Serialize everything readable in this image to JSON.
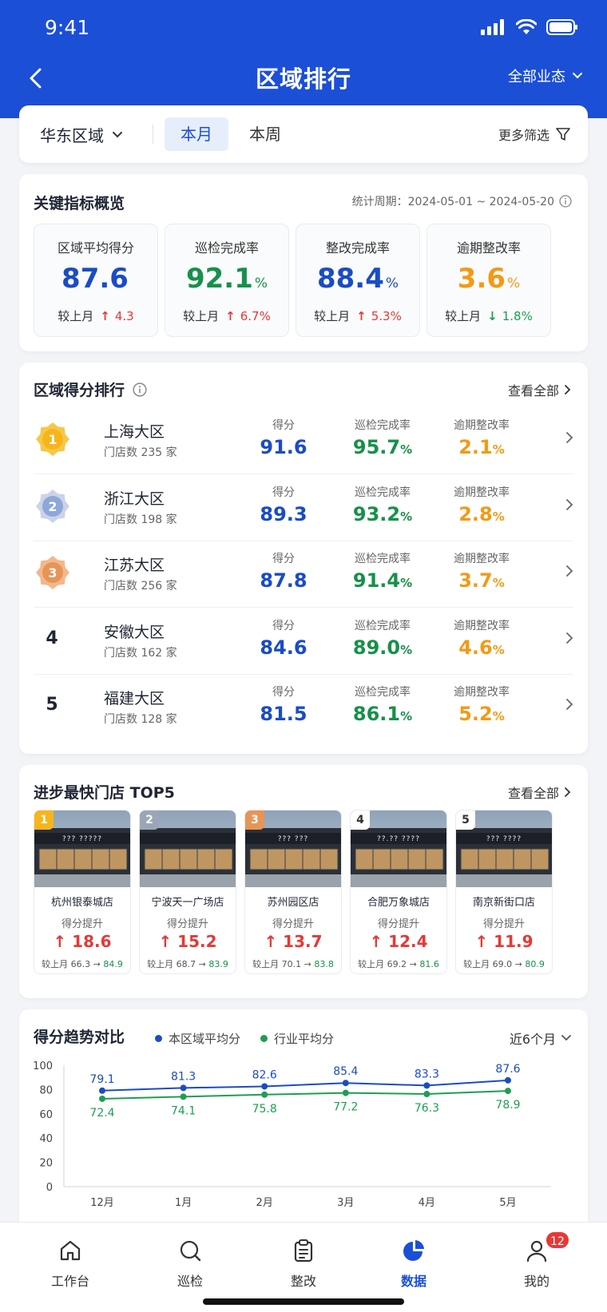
{
  "status_bar": {
    "time": "9:41"
  },
  "nav": {
    "title": "区域排行",
    "right_label": "全部业态"
  },
  "filter": {
    "region": "华东区域",
    "segments": [
      "本月",
      "本周"
    ],
    "active_segment": 0,
    "more": "更多筛选"
  },
  "kpi": {
    "title": "关键指标概览",
    "period": "统计周期：2024-05-01 ~ 2024-05-20",
    "items": [
      {
        "label": "区域平均得分",
        "value": "87.6",
        "unit": "",
        "compare_label": "较上月",
        "direction": "up",
        "change": "4.3",
        "color": "#1a4cc4"
      },
      {
        "label": "巡检完成率",
        "value": "92.1",
        "unit": "%",
        "compare_label": "较上月",
        "direction": "up",
        "change": "6.7%",
        "color": "#17904a"
      },
      {
        "label": "整改完成率",
        "value": "88.4",
        "unit": "%",
        "compare_label": "较上月",
        "direction": "up",
        "change": "5.3%",
        "color": "#1a4cc4"
      },
      {
        "label": "逾期整改率",
        "value": "3.6",
        "unit": "%",
        "compare_label": "较上月",
        "direction": "down",
        "change": "1.8%",
        "color": "#f29a16"
      }
    ]
  },
  "ranking": {
    "title": "区域得分排行",
    "link": "查看全部",
    "col_labels": {
      "score": "得分",
      "inspect": "巡检完成率",
      "overdue": "逾期整改率"
    },
    "rows": [
      {
        "rank": "1",
        "name": "上海大区",
        "stores": "门店数 235 家",
        "score": "91.6",
        "inspect": "95.7",
        "overdue": "2.1"
      },
      {
        "rank": "2",
        "name": "浙江大区",
        "stores": "门店数 198 家",
        "score": "89.3",
        "inspect": "93.2",
        "overdue": "2.8"
      },
      {
        "rank": "3",
        "name": "江苏大区",
        "stores": "门店数 256 家",
        "score": "87.8",
        "inspect": "91.4",
        "overdue": "3.7"
      },
      {
        "rank": "4",
        "name": "安徽大区",
        "stores": "门店数 162 家",
        "score": "84.6",
        "inspect": "89.0",
        "overdue": "4.6"
      },
      {
        "rank": "5",
        "name": "福建大区",
        "stores": "门店数 128 家",
        "score": "81.5",
        "inspect": "86.1",
        "overdue": "5.2"
      }
    ],
    "unit": "%"
  },
  "stores": {
    "title": "进步最快门店 TOP5",
    "link": "查看全部",
    "metric_label": "得分提升",
    "items": [
      {
        "rank": "1",
        "name": "杭州银泰城店",
        "gain": "↑ 18.6",
        "compare_prefix": "较上月 66.3 → ",
        "compare_to": "84.9",
        "sign": "??? ?????"
      },
      {
        "rank": "2",
        "name": "宁波天一广场店",
        "gain": "↑ 15.2",
        "compare_prefix": "较上月 68.7 → ",
        "compare_to": "83.9",
        "sign": ""
      },
      {
        "rank": "3",
        "name": "苏州园区店",
        "gain": "↑ 13.7",
        "compare_prefix": "较上月 70.1 → ",
        "compare_to": "83.8",
        "sign": "??? ???"
      },
      {
        "rank": "4",
        "name": "合肥万象城店",
        "gain": "↑ 12.4",
        "compare_prefix": "较上月 69.2 → ",
        "compare_to": "81.6",
        "sign": "??.?? ????"
      },
      {
        "rank": "5",
        "name": "南京新街口店",
        "gain": "↑ 11.9",
        "compare_prefix": "较上月 69.0 → ",
        "compare_to": "80.9",
        "sign": "??? ????"
      }
    ]
  },
  "trend": {
    "title": "得分趋势对比",
    "legend": [
      "本区域平均分",
      "行业平均分"
    ],
    "range_label": "近6个月"
  },
  "chart_data": {
    "type": "line",
    "x": [
      "12月",
      "1月",
      "2月",
      "3月",
      "4月",
      "5月"
    ],
    "ylim": [
      0,
      100
    ],
    "yticks": [
      0,
      20,
      40,
      60,
      80,
      100
    ],
    "series": [
      {
        "name": "本区域平均分",
        "values": [
          79.1,
          81.3,
          82.6,
          85.4,
          83.3,
          87.6
        ],
        "color": "#1a4cc4"
      },
      {
        "name": "行业平均分",
        "values": [
          72.4,
          74.1,
          75.8,
          77.2,
          76.3,
          78.9
        ],
        "color": "#1e9e52"
      }
    ]
  },
  "tabbar": {
    "items": [
      "工作台",
      "巡检",
      "整改",
      "数据",
      "我的"
    ],
    "active": 3,
    "badge": "12"
  }
}
